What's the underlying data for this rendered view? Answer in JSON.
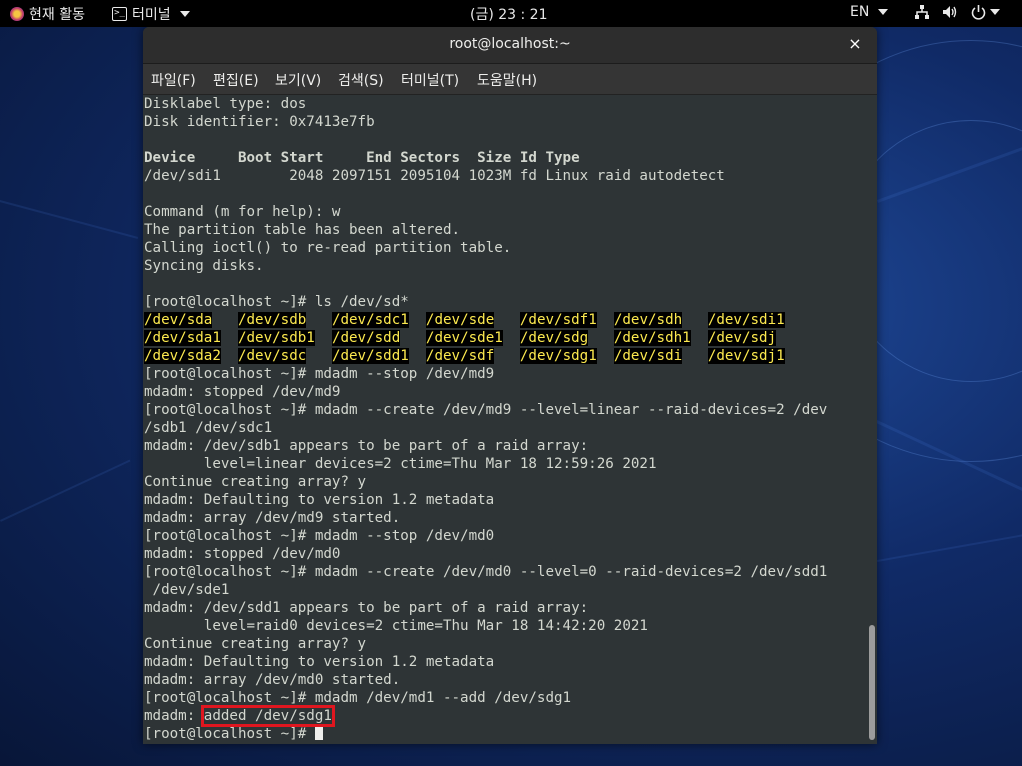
{
  "topbar": {
    "activities": "현재 활동",
    "app_menu": "터미널",
    "clock": "(금) 23 : 21",
    "language": "EN",
    "icons": [
      "network-icon",
      "volume-icon",
      "power-icon"
    ]
  },
  "window": {
    "title": "root@localhost:~",
    "close": "×"
  },
  "menu": [
    "파일(F)",
    "편집(E)",
    "보기(V)",
    "검색(S)",
    "터미널(T)",
    "도움말(H)"
  ],
  "terminal": {
    "lines": [
      "Disklabel type: dos",
      "Disk identifier: 0x7413e7fb",
      "",
      "Device     Boot Start     End Sectors  Size Id Type",
      "/dev/sdi1        2048 2097151 2095104 1023M fd Linux raid autodetect",
      "",
      "Command (m for help): w",
      "The partition table has been altered.",
      "Calling ioctl() to re-read partition table.",
      "Syncing disks.",
      "",
      "[root@localhost ~]# ls /dev/sd*",
      "",
      "",
      "",
      "[root@localhost ~]# mdadm --stop /dev/md9",
      "mdadm: stopped /dev/md9",
      "[root@localhost ~]# mdadm --create /dev/md9 --level=linear --raid-devices=2 /dev",
      "/sdb1 /dev/sdc1",
      "mdadm: /dev/sdb1 appears to be part of a raid array:",
      "       level=linear devices=2 ctime=Thu Mar 18 12:59:26 2021",
      "Continue creating array? y",
      "mdadm: Defaulting to version 1.2 metadata",
      "mdadm: array /dev/md9 started.",
      "[root@localhost ~]# mdadm --stop /dev/md0",
      "mdadm: stopped /dev/md0",
      "[root@localhost ~]# mdadm --create /dev/md0 --level=0 --raid-devices=2 /dev/sdd1",
      " /dev/sde1",
      "mdadm: /dev/sdd1 appears to be part of a raid array:",
      "       level=raid0 devices=2 ctime=Thu Mar 18 14:42:20 2021",
      "Continue creating array? y",
      "mdadm: Defaulting to version 1.2 metadata",
      "mdadm: array /dev/md0 started.",
      "[root@localhost ~]# mdadm /dev/md1 --add /dev/sdg1"
    ],
    "bold_line_index": 3,
    "device_listing_start": 12,
    "devices": [
      [
        "/dev/sda",
        "/dev/sdb",
        "/dev/sdc1",
        "/dev/sde",
        "/dev/sdf1",
        "/dev/sdh",
        "/dev/sdi1"
      ],
      [
        "/dev/sda1",
        "/dev/sdb1",
        "/dev/sdd",
        "/dev/sde1",
        "/dev/sdg",
        "/dev/sdh1",
        "/dev/sdj"
      ],
      [
        "/dev/sda2",
        "/dev/sdc",
        "/dev/sdd1",
        "/dev/sdf",
        "/dev/sdg1",
        "/dev/sdi",
        "/dev/sdj1"
      ]
    ],
    "last_output_prefix": "mdadm: ",
    "highlighted_text": "added /dev/sdg1",
    "prompt": "[root@localhost ~]# "
  }
}
